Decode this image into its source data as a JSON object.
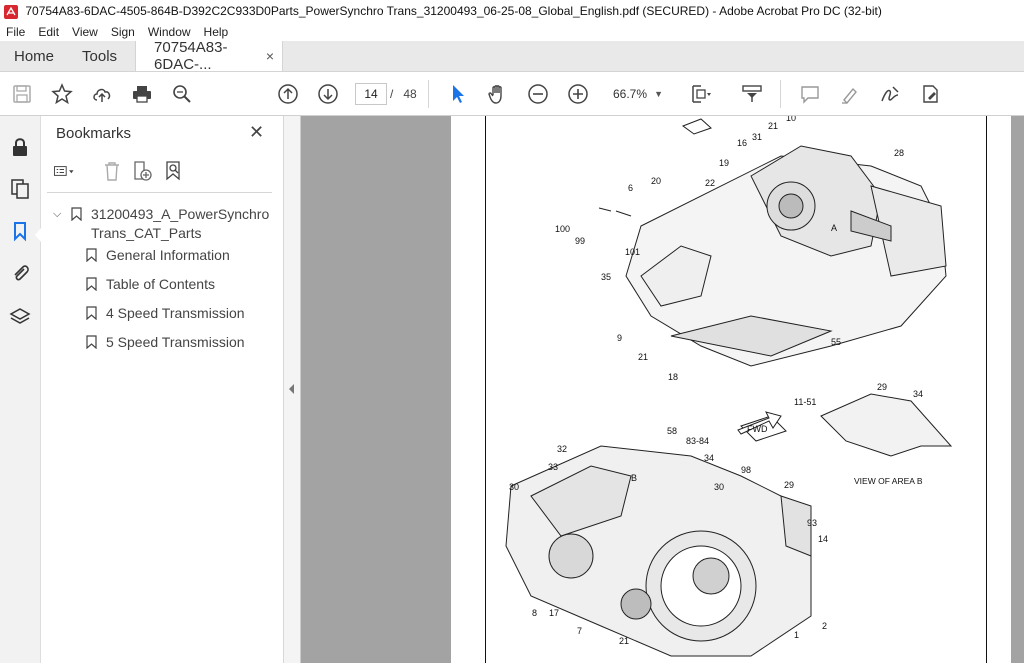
{
  "window": {
    "title": "70754A83-6DAC-4505-864B-D392C2C933D0Parts_PowerSynchro Trans_31200493_06-25-08_Global_English.pdf (SECURED) - Adobe Acrobat Pro DC (32-bit)"
  },
  "menu": {
    "items": [
      "File",
      "Edit",
      "View",
      "Sign",
      "Window",
      "Help"
    ]
  },
  "tabs": {
    "home": "Home",
    "tools": "Tools",
    "document": "70754A83-6DAC-...",
    "close": "×"
  },
  "toolbar": {
    "current_page": "14",
    "page_separator": "/",
    "total_pages": "48",
    "zoom": "66.7%",
    "icons": [
      "save-icon",
      "bookmark-star-icon",
      "upload-cloud-icon",
      "print-icon",
      "search-icon",
      "prev-page-icon",
      "next-page-icon",
      "select-cursor-icon",
      "hand-icon",
      "zoom-out-icon",
      "zoom-in-icon",
      "page-fit-icon",
      "scroll-mode-icon",
      "comment-icon",
      "highlight-icon",
      "sign-icon",
      "fill-sign-icon"
    ]
  },
  "left_rail": {
    "icons": [
      "lock-icon",
      "pages-icon",
      "bookmarks-icon",
      "attachment-icon",
      "layers-icon"
    ]
  },
  "bookmarks": {
    "title": "Bookmarks",
    "close": "✕",
    "root": {
      "label_line1": "31200493_A_PowerSynchro",
      "label_line2": "Trans_CAT_Parts"
    },
    "items": [
      {
        "label": "General Information"
      },
      {
        "label": "Table of Contents"
      },
      {
        "label": "4 Speed Transmission"
      },
      {
        "label": "5 Speed Transmission"
      }
    ]
  },
  "document": {
    "callouts_top": [
      "10",
      "31",
      "21",
      "16",
      "28",
      "19",
      "22",
      "20",
      "6",
      "100",
      "99",
      "101",
      "35",
      "9",
      "21",
      "18",
      "55"
    ],
    "callouts_bottom": [
      "29",
      "34",
      "11-51",
      "58",
      "83-84",
      "32",
      "33",
      "34",
      "30",
      "98",
      "30",
      "29",
      "93",
      "14",
      "8",
      "17",
      "7",
      "21",
      "1",
      "2"
    ],
    "area_labels": [
      "A",
      "B"
    ],
    "view_label": "VIEW OF AREA B",
    "fwd_label": "FWD"
  },
  "colors": {
    "accent_blue": "#1a73e8",
    "doc_background": "#a3a3a3",
    "tabbar": "#e9e9e9"
  }
}
